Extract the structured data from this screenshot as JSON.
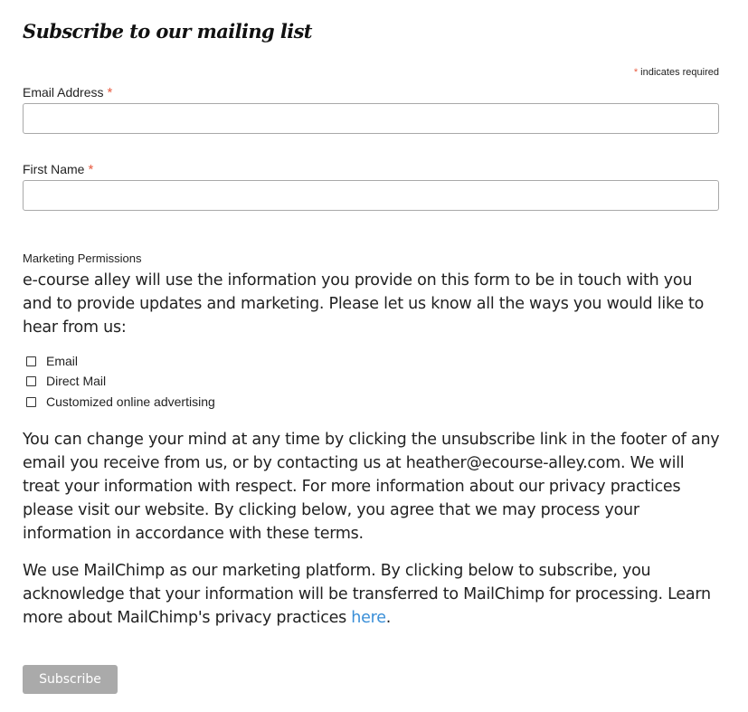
{
  "form": {
    "title": "Subscribe to our mailing list",
    "required_note": {
      "asterisk": "*",
      "text": "indicates required"
    },
    "fields": {
      "email": {
        "label": "Email Address",
        "required_marker": "*",
        "value": "",
        "placeholder": ""
      },
      "first_name": {
        "label": "First Name",
        "required_marker": "*",
        "value": "",
        "placeholder": ""
      }
    },
    "marketing_permissions": {
      "heading": "Marketing Permissions",
      "description": "e-course alley will use the information you provide on this form to be in touch with you and to provide updates and marketing. Please let us know all the ways you would like to hear from us:",
      "options": [
        {
          "label": "Email",
          "checked": false
        },
        {
          "label": "Direct Mail",
          "checked": false
        },
        {
          "label": "Customized online advertising",
          "checked": false
        }
      ]
    },
    "unsubscribe_text": "You can change your mind at any time by clicking the unsubscribe link in the footer of any email you receive from us, or by contacting us at heather@ecourse-alley.com. We will treat your information with respect. For more information about our privacy practices please visit our website. By clicking below, you agree that we may process your information in accordance with these terms.",
    "mailchimp_text": {
      "before_link": "We use MailChimp as our marketing platform. By clicking below to subscribe, you acknowledge that your information will be transferred to MailChimp for processing. Learn more about MailChimp's privacy practices ",
      "link_label": "here",
      "after_link": "."
    },
    "subscribe_label": "Subscribe",
    "colors": {
      "asterisk": "#e85c41",
      "link": "#3a8fd8",
      "button_bg": "#aaaaaa",
      "input_border": "#a9a9a9"
    }
  }
}
